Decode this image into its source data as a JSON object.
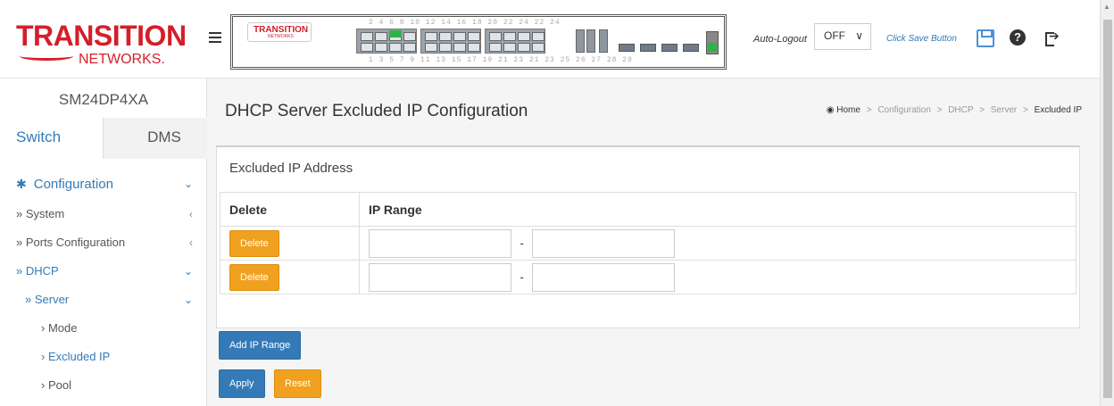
{
  "brand": {
    "logo_main": "TRANSITION",
    "logo_sub": "NETWORKS.",
    "device_logo_main": "TRANSITION",
    "device_logo_sub": "NETWORKS",
    "accent_color": "#d31f2a"
  },
  "device_panel": {
    "top_port_numbers": "2  4  6  8  10 12 14 16  18 20 22 24   22 24",
    "bottom_port_numbers": "1  3  5  7  9  11 13 15  17 19 21 23   21 23    25  26  27  28   29"
  },
  "header": {
    "auto_logout_label": "Auto-Logout",
    "auto_logout_value": "OFF",
    "save_link": "Click Save Button",
    "icons": [
      "save-icon",
      "help-icon",
      "logout-icon"
    ]
  },
  "sidebar": {
    "device_name": "SM24DP4XA",
    "tabs": [
      {
        "label": "Switch"
      },
      {
        "label": "DMS"
      }
    ],
    "section": "Configuration",
    "items": [
      {
        "label": "» System"
      },
      {
        "label": "» Ports Configuration"
      },
      {
        "label": "» DHCP"
      },
      {
        "label": "» Server"
      },
      {
        "label": "› Mode"
      },
      {
        "label": "› Excluded IP"
      },
      {
        "label": "› Pool"
      }
    ]
  },
  "main": {
    "title": "DHCP Server Excluded IP Configuration",
    "breadcrumb": [
      "Home",
      "Configuration",
      "DHCP",
      "Server",
      "Excluded IP"
    ],
    "panel_title": "Excluded IP Address",
    "columns": [
      "Delete",
      "IP Range"
    ],
    "rows": [
      {
        "delete_label": "Delete",
        "range_sep": "-",
        "start": "",
        "end": ""
      },
      {
        "delete_label": "Delete",
        "range_sep": "-",
        "start": "",
        "end": ""
      }
    ],
    "add_button": "Add IP Range",
    "apply_button": "Apply",
    "reset_button": "Reset"
  }
}
